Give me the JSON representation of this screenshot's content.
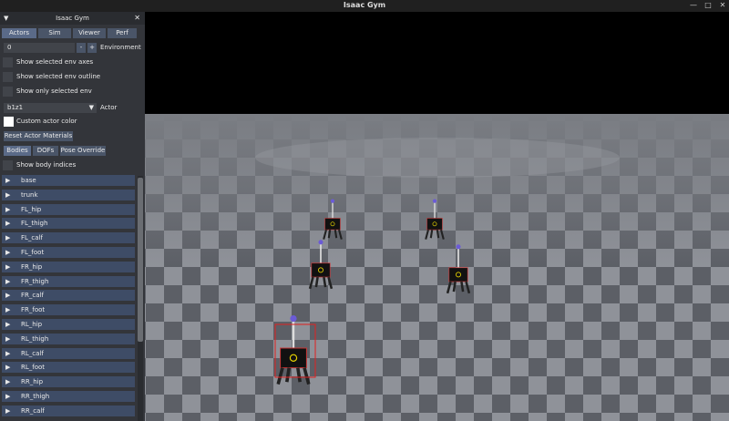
{
  "window": {
    "title": "Isaac Gym",
    "controls": [
      "—",
      "□",
      "✕"
    ]
  },
  "panel": {
    "title": "Isaac Gym",
    "collapse_glyph": "▼",
    "close_glyph": "✕",
    "tabs": [
      "Actors",
      "Sim",
      "Viewer",
      "Perf"
    ],
    "env_value": "0",
    "env_minus": "-",
    "env_plus": "+",
    "env_label": "Environment",
    "checks": [
      "Show selected env axes",
      "Show selected env outline",
      "Show only selected env"
    ],
    "actor_value": "b1z1",
    "actor_label": "Actor",
    "dropdown_glyph": "▼",
    "custom_color_label": "Custom actor color",
    "reset_materials": "Reset Actor Materials",
    "subtabs": [
      "Bodies",
      "DOFs",
      "Pose Override"
    ],
    "show_body_indices": "Show body indices",
    "expand_glyph": "▶",
    "bodies": [
      "base",
      "trunk",
      "FL_hip",
      "FL_thigh",
      "FL_calf",
      "FL_foot",
      "FR_hip",
      "FR_thigh",
      "FR_calf",
      "FR_foot",
      "RL_hip",
      "RL_thigh",
      "RL_calf",
      "RL_foot",
      "RR_hip",
      "RR_thigh",
      "RR_calf"
    ]
  },
  "colors": {
    "panel_bg": "#33353a",
    "tab": "#4a5568",
    "accent_bbox": "#e02020"
  }
}
